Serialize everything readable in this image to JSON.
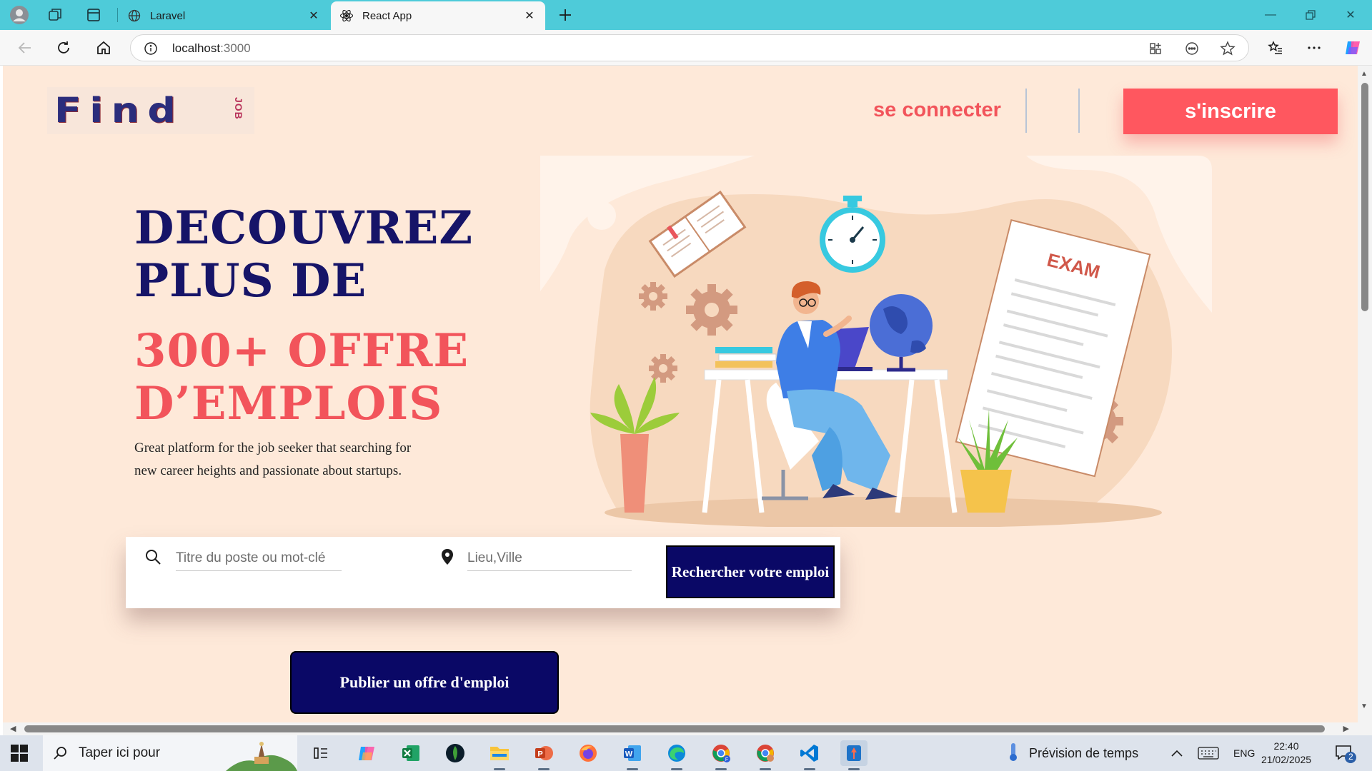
{
  "browser": {
    "tabs": [
      {
        "title": "Laravel",
        "active": false
      },
      {
        "title": "React App",
        "active": true
      }
    ],
    "url_host": "localhost",
    "url_port": ":3000"
  },
  "page": {
    "logo_text": "Find",
    "logo_sub": "JOB",
    "nav": {
      "login": "se connecter",
      "signup": "s'inscrire"
    },
    "hero": {
      "line1": "Decouvrez",
      "line2": "plus de",
      "line3": "300+ Offre",
      "line4": "d’emplois",
      "subtitle": "Great platform for the job seeker that searching for new career heights and passionate about startups."
    },
    "search": {
      "keyword_placeholder": "Titre du poste ou mot-clé",
      "location_placeholder": "Lieu,Ville",
      "button": "Rechercher votre emploi"
    },
    "publish_button": "Publier un offre d'emploi",
    "illustration_text": "EXAM"
  },
  "taskbar": {
    "search_text": "Taper ici pour",
    "weather": "Prévision de temps",
    "lang": "ENG",
    "time": "22:40",
    "date": "21/02/2025",
    "notifications": "2",
    "apps": [
      "task-view",
      "copilot",
      "excel",
      "mongodb-compass",
      "file-explorer",
      "powerpoint",
      "firefox",
      "word",
      "edge",
      "chrome-profile-f",
      "chrome",
      "vscode",
      "postman-active"
    ]
  },
  "colors": {
    "tab_strip": "#4ecbd9",
    "page_bg": "#fee9d9",
    "navy": "#0a0866",
    "accent_red": "#ff575f"
  }
}
